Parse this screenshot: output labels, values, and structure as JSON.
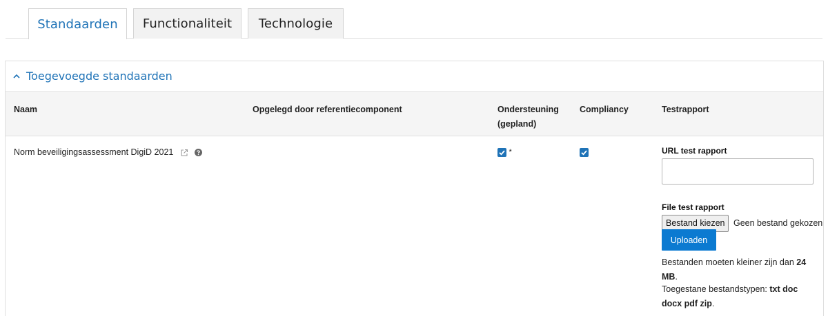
{
  "tabs": [
    {
      "label": "Standaarden",
      "active": true
    },
    {
      "label": "Functionaliteit",
      "active": false
    },
    {
      "label": "Technologie",
      "active": false
    }
  ],
  "panel": {
    "title": "Toegevoegde standaarden",
    "columns": [
      "Naam",
      "Opgelegd door referentiecomponent",
      "Ondersteuning (gepland)",
      "Compliancy",
      "Testrapport"
    ],
    "column_lines": {
      "support_line1": "Ondersteuning",
      "support_line2": "(gepland)"
    },
    "row": {
      "name": "Norm beveiligingsassessment DigiD 2021",
      "name_icons": [
        "external-link-icon",
        "question-circle-icon"
      ],
      "imposed_by": "",
      "support_checked": true,
      "support_marker": "*",
      "compliancy_checked": true,
      "testrapport": {
        "url_label": "URL test rapport",
        "url_value": "",
        "file_label": "File test rapport",
        "file_button": "Bestand kiezen",
        "file_status": "Geen bestand gekozen",
        "upload_button": "Uploaden",
        "size_note_prefix": "Bestanden moeten kleiner zijn dan",
        "size_value": "24",
        "size_unit": "MB",
        "types_prefix": "Toegestane bestandstypen:",
        "types_line1": "txt doc",
        "types_line2": "docx pdf zip"
      }
    }
  },
  "colors": {
    "accent": "#1f73b7",
    "button": "#0b7ad1"
  }
}
